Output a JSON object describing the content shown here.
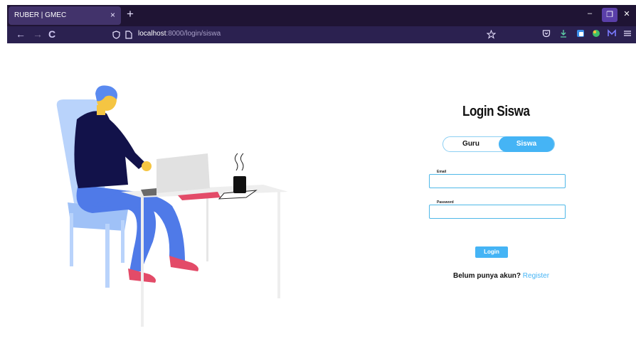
{
  "browser": {
    "tab_title": "RUBER | GMEC",
    "tab_close": "×",
    "new_tab": "+",
    "url_host": "localhost",
    "url_path": ":8000/login/siswa",
    "nav_back": "←",
    "nav_forward": "→",
    "nav_reload": "C",
    "minimize": "–",
    "restore": "❐",
    "close": "✕"
  },
  "login": {
    "title": "Login Siswa",
    "toggle_guru": "Guru",
    "toggle_siswa": "Siswa",
    "email_label": "Email",
    "password_label": "Password",
    "button_label": "Login",
    "register_prompt": "Belum punya akun?",
    "register_link": "Register"
  },
  "colors": {
    "accent": "#45b4f5",
    "chrome_dark": "#1f1434",
    "chrome_bar": "#2b2150",
    "tab_active": "#42336b"
  },
  "icons": {
    "tracking": "shield-icon",
    "page": "page-icon",
    "bookmark": "star-icon",
    "pocket": "pocket-icon",
    "download": "download-icon",
    "illustration": "person-at-desk-illustration"
  }
}
